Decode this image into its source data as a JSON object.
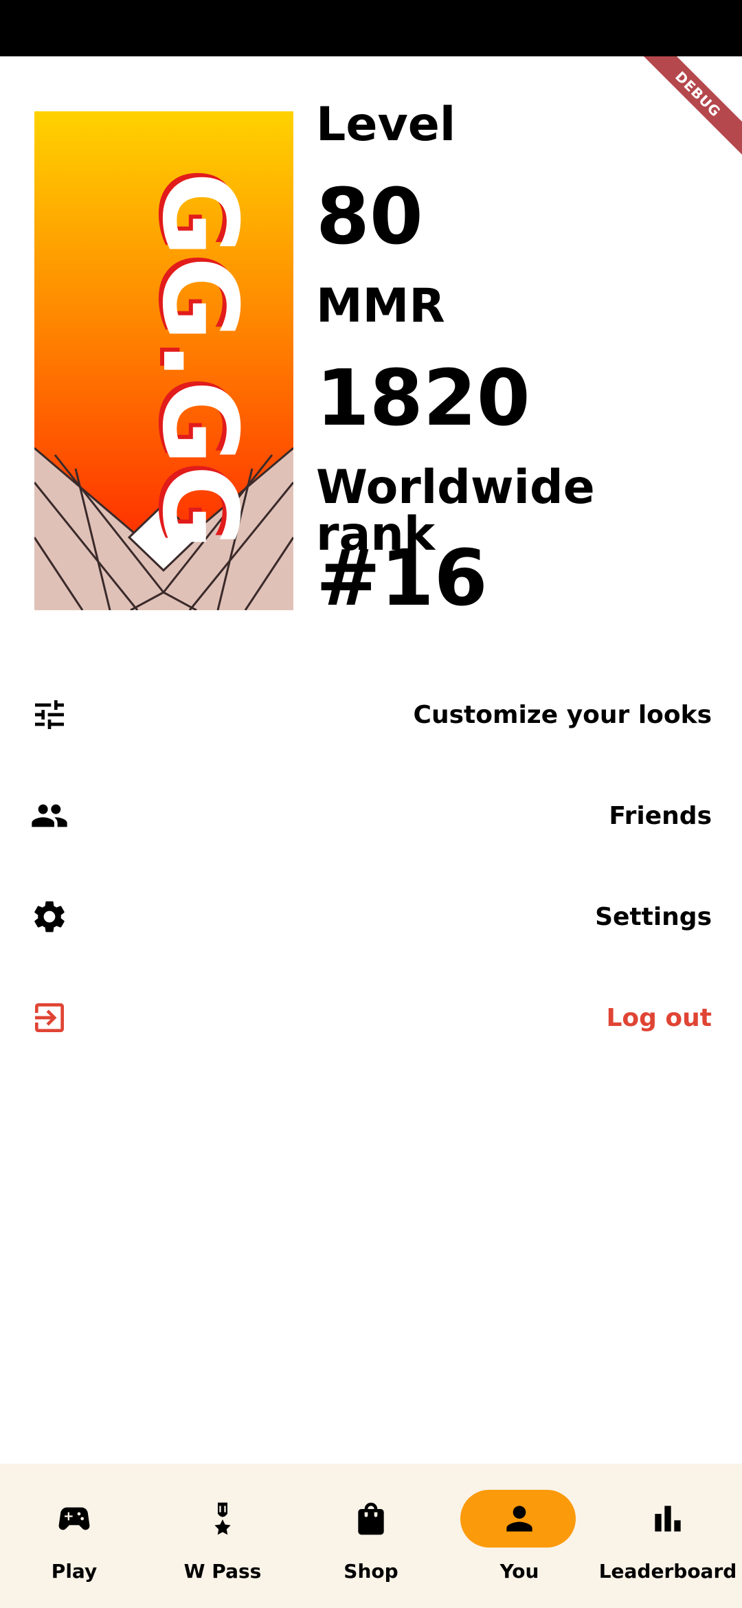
{
  "debug_banner": "DEBUG",
  "profile": {
    "card_logo_text": "GG.GG",
    "level_label": "Level",
    "level_value": "80",
    "mmr_label": "MMR",
    "mmr_value": "1820",
    "rank_label": "Worldwide rank",
    "rank_value": "#16"
  },
  "menu": [
    {
      "label": "Customize your looks",
      "icon": "tune-icon"
    },
    {
      "label": "Friends",
      "icon": "people-icon"
    },
    {
      "label": "Settings",
      "icon": "gear-icon"
    },
    {
      "label": "Log out",
      "icon": "logout-icon"
    }
  ],
  "nav": [
    {
      "label": "Play",
      "icon": "gamepad-icon",
      "active": false
    },
    {
      "label": "W Pass",
      "icon": "medal-icon",
      "active": false
    },
    {
      "label": "Shop",
      "icon": "shopping-bag-icon",
      "active": false
    },
    {
      "label": "You",
      "icon": "person-icon",
      "active": true
    },
    {
      "label": "Leaderboard",
      "icon": "bar-chart-icon",
      "active": false
    }
  ],
  "colors": {
    "accent": "#fb9a0a",
    "logout": "#e04434",
    "nav_background": "#faf3e8",
    "debug_ribbon": "#b5484d"
  }
}
